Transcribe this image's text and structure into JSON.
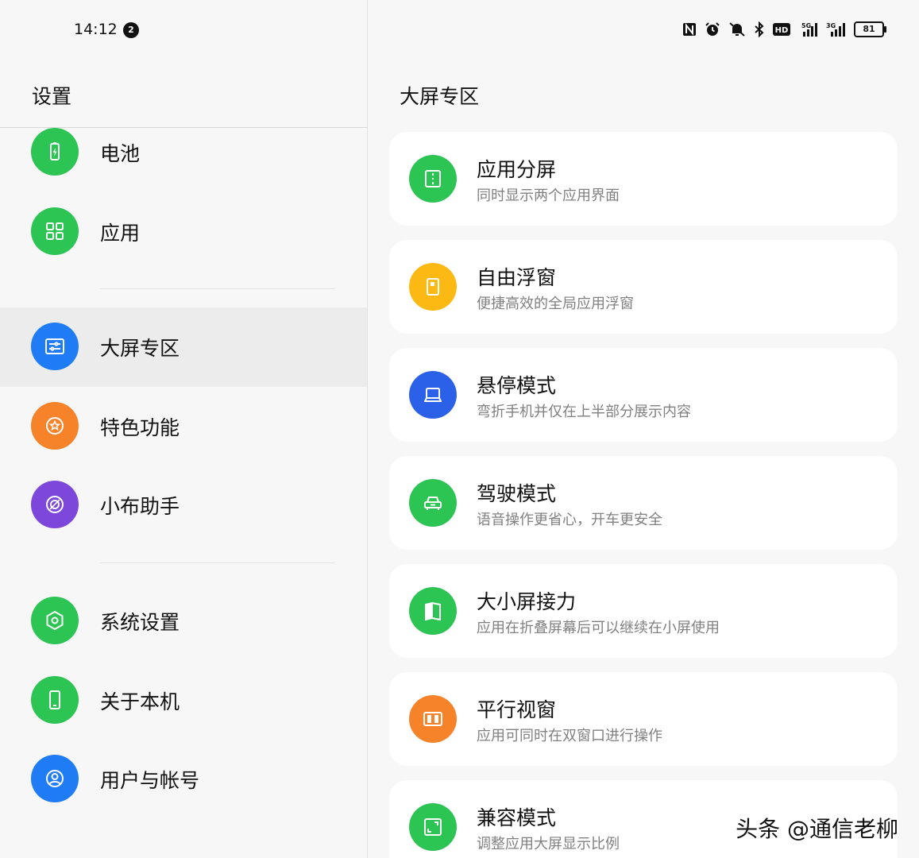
{
  "status_bar": {
    "time": "14:12",
    "notification_count": "2",
    "signal_1_label": "5G",
    "signal_2_label": "3G",
    "hd_label": "HD",
    "battery": "81",
    "icons": [
      "nfc-icon",
      "alarm-icon",
      "mute-icon",
      "bluetooth-icon",
      "hd-icon",
      "signal-5g-icon",
      "signal-3g-icon",
      "battery-icon"
    ]
  },
  "sidebar": {
    "title": "设置",
    "items": [
      {
        "label": "电池",
        "icon": "battery-icon",
        "color": "#2cc453"
      },
      {
        "label": "应用",
        "icon": "apps-grid-icon",
        "color": "#2cc453"
      },
      {
        "label": "大屏专区",
        "icon": "large-screen-icon",
        "color": "#1f7cf5",
        "active": true
      },
      {
        "label": "特色功能",
        "icon": "star-icon",
        "color": "#f6822a"
      },
      {
        "label": "小布助手",
        "icon": "assistant-icon",
        "color": "#7e47dc"
      },
      {
        "label": "系统设置",
        "icon": "hexagon-gear-icon",
        "color": "#2cc453"
      },
      {
        "label": "关于本机",
        "icon": "phone-icon",
        "color": "#2cc453"
      },
      {
        "label": "用户与帐号",
        "icon": "user-icon",
        "color": "#1f7cf5"
      }
    ]
  },
  "main": {
    "title": "大屏专区",
    "cards": [
      {
        "title": "应用分屏",
        "subtitle": "同时显示两个应用界面",
        "icon": "split-screen-icon",
        "color": "#2cc453"
      },
      {
        "title": "自由浮窗",
        "subtitle": "便捷高效的全局应用浮窗",
        "icon": "floating-window-icon",
        "color": "#fdb913"
      },
      {
        "title": "悬停模式",
        "subtitle": "弯折手机并仅在上半部分展示内容",
        "icon": "laptop-icon",
        "color": "#2b60e8"
      },
      {
        "title": "驾驶模式",
        "subtitle": "语音操作更省心，开车更安全",
        "icon": "car-icon",
        "color": "#2cc453"
      },
      {
        "title": "大小屏接力",
        "subtitle": "应用在折叠屏幕后可以继续在小屏使用",
        "icon": "book-fold-icon",
        "color": "#2cc453"
      },
      {
        "title": "平行视窗",
        "subtitle": "应用可同时在双窗口进行操作",
        "icon": "parallel-window-icon",
        "color": "#f6822a"
      },
      {
        "title": "兼容模式",
        "subtitle": "调整应用大屏显示比例",
        "icon": "aspect-ratio-icon",
        "color": "#2cc453"
      }
    ]
  },
  "watermark": "头条 @通信老柳"
}
